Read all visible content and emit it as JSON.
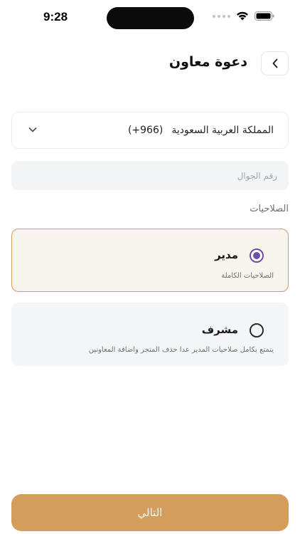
{
  "status_bar": {
    "time": "9:28"
  },
  "header": {
    "title": "دعوة معاون"
  },
  "country": {
    "name": "المملكة العربية السعودية",
    "code": "(+966)"
  },
  "phone": {
    "placeholder": "رقم الجوال",
    "value": ""
  },
  "permissions_label": "الصلاحيات",
  "roles": [
    {
      "title": "مدير",
      "description": "الصلاحيات الكاملة",
      "selected": true
    },
    {
      "title": "مشرف",
      "description": "يتمتع بكامل صلاحيات المدير عدا حذف المتجر واضافة المعاونين",
      "selected": false
    }
  ],
  "next_button": {
    "label": "التالي"
  },
  "colors": {
    "accent": "#d39d5c",
    "radio_selected": "#6f4fa0",
    "selected_card_bg": "#f7f3ed",
    "field_bg": "#f3f4f6"
  },
  "icons": {
    "back": "chevron-left-icon",
    "dropdown": "chevron-down-icon",
    "wifi": "wifi-icon",
    "battery": "battery-icon",
    "signal": "signal-dots-icon"
  }
}
